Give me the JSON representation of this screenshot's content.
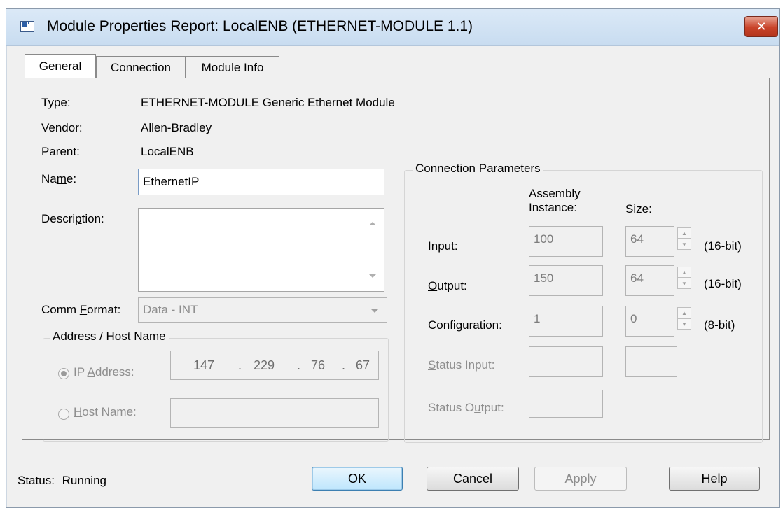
{
  "window": {
    "title": "Module Properties Report: LocalENB (ETHERNET-MODULE 1.1)",
    "close_label": "✕"
  },
  "tabs": [
    {
      "label": "General"
    },
    {
      "label": "Connection"
    },
    {
      "label": "Module Info"
    }
  ],
  "general": {
    "type_label": "Type:",
    "type_value": "ETHERNET-MODULE Generic Ethernet Module",
    "vendor_label": "Vendor:",
    "vendor_value": "Allen-Bradley",
    "parent_label": "Parent:",
    "parent_value": "LocalENB",
    "name_label_pre": "Na",
    "name_label_ul": "m",
    "name_label_post": "e:",
    "name_value": "EthernetIP",
    "desc_label_pre": "Descri",
    "desc_label_ul": "p",
    "desc_label_post": "tion:",
    "desc_value": "",
    "comm_label_pre": "Comm ",
    "comm_label_ul": "F",
    "comm_label_post": "ormat:",
    "comm_value": "Data - INT"
  },
  "address": {
    "group_title": "Address / Host Name",
    "ip_label_pre": "IP ",
    "ip_label_ul": "A",
    "ip_label_post": "ddress:",
    "ip": [
      "147",
      "229",
      "76",
      "67"
    ],
    "ip_dot": ".",
    "host_label_pre": "",
    "host_label_ul": "H",
    "host_label_post": "ost Name:",
    "host_value": ""
  },
  "conn_params": {
    "group_title": "Connection Parameters",
    "assembly_header_1": "Assembly",
    "assembly_header_2": "Instance:",
    "size_header": "Size:",
    "rows": [
      {
        "label_ul": "I",
        "label_rest": "nput:",
        "instance": "100",
        "size": "64",
        "unit": "(16-bit)"
      },
      {
        "label_ul": "O",
        "label_mid": "",
        "label_rest": "utput:",
        "instance": "150",
        "size": "64",
        "unit": "(16-bit)"
      },
      {
        "label_ul": "C",
        "label_rest": "onfiguration:",
        "instance": "1",
        "size": "0",
        "unit": "(8-bit)"
      }
    ],
    "status_input_ul": "S",
    "status_input_rest": "tatus Input:",
    "status_output_pre": "Status O",
    "status_output_ul": "u",
    "status_output_post": "tput:"
  },
  "footer": {
    "status_label": "Status:",
    "status_value": "Running",
    "ok_label": "OK",
    "cancel_label": "Cancel",
    "apply_label": "Apply",
    "help_label": "Help"
  }
}
